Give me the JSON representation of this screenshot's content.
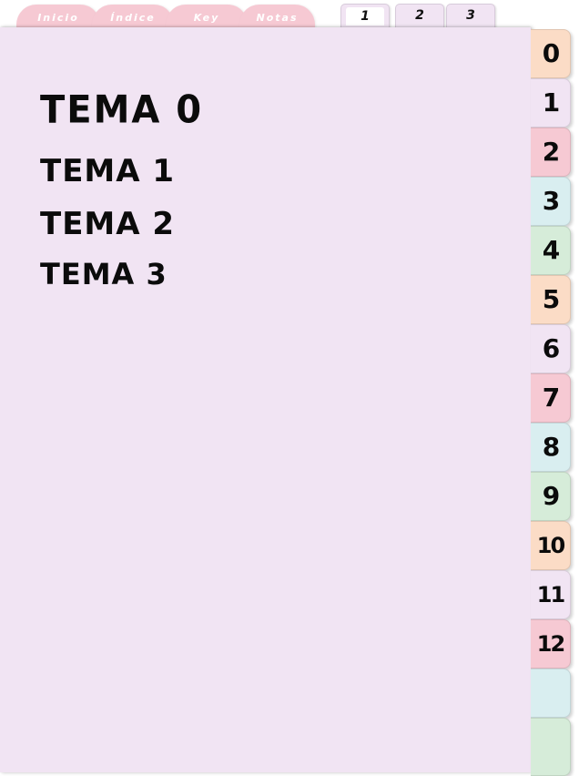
{
  "nav_tabs": [
    {
      "label": "Inicio"
    },
    {
      "label": "Índice"
    },
    {
      "label": "Key"
    },
    {
      "label": "Notas"
    }
  ],
  "page_tabs": [
    {
      "label": "1",
      "active": true
    },
    {
      "label": "2",
      "active": false
    },
    {
      "label": "3",
      "active": false
    }
  ],
  "topics": [
    {
      "label": "TEMA 0"
    },
    {
      "label": "TEMA 1"
    },
    {
      "label": "TEMA 2"
    },
    {
      "label": "TEMA 3"
    }
  ],
  "side_tabs": [
    {
      "label": "0",
      "color": "#fbdcc6"
    },
    {
      "label": "1",
      "color": "#f1e4f3"
    },
    {
      "label": "2",
      "color": "#f6c9d3"
    },
    {
      "label": "3",
      "color": "#d9eef0"
    },
    {
      "label": "4",
      "color": "#d6ecd9"
    },
    {
      "label": "5",
      "color": "#fbdcc6"
    },
    {
      "label": "6",
      "color": "#f1e4f3"
    },
    {
      "label": "7",
      "color": "#f6c9d3"
    },
    {
      "label": "8",
      "color": "#d9eef0"
    },
    {
      "label": "9",
      "color": "#d6ecd9"
    },
    {
      "label": "10",
      "color": "#fbdcc6"
    },
    {
      "label": "11",
      "color": "#f1e4f3"
    },
    {
      "label": "12",
      "color": "#f6c9d3"
    },
    {
      "label": "",
      "color": "#d9eef0"
    },
    {
      "label": "",
      "color": "#d6ecd9"
    }
  ]
}
